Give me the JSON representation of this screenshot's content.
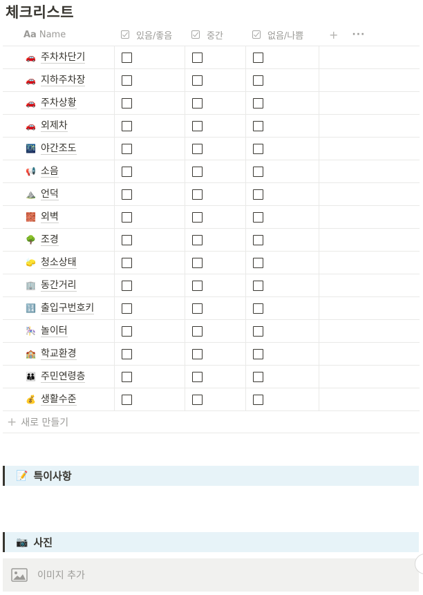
{
  "page": {
    "title": "체크리스트"
  },
  "table": {
    "headers": {
      "name": "Name",
      "col_a": "있음/좋음",
      "col_b": "중간",
      "col_c": "없음/나쁨",
      "name_icon": "Aa",
      "add_icon": "+",
      "more_icon": "···"
    },
    "rows": [
      {
        "emoji": "🚗",
        "label": "주차차단기",
        "checked": [
          false,
          false,
          false
        ]
      },
      {
        "emoji": "🚗",
        "label": "지하주차장",
        "checked": [
          false,
          false,
          false
        ]
      },
      {
        "emoji": "🚗",
        "label": "주차상황",
        "checked": [
          false,
          false,
          false
        ]
      },
      {
        "emoji": "🚗",
        "label": "외제차",
        "checked": [
          false,
          false,
          false
        ]
      },
      {
        "emoji": "🌃",
        "label": "야간조도",
        "checked": [
          false,
          false,
          false
        ]
      },
      {
        "emoji": "📢",
        "label": "소음",
        "checked": [
          false,
          false,
          false
        ]
      },
      {
        "emoji": "⛰️",
        "label": "언덕",
        "checked": [
          false,
          false,
          false
        ]
      },
      {
        "emoji": "🧱",
        "label": "외벽",
        "checked": [
          false,
          false,
          false
        ]
      },
      {
        "emoji": "🌳",
        "label": "조경",
        "checked": [
          false,
          false,
          false
        ]
      },
      {
        "emoji": "🧽",
        "label": "청소상태",
        "checked": [
          false,
          false,
          false
        ]
      },
      {
        "emoji": "🏢",
        "label": "동간거리",
        "checked": [
          false,
          false,
          false
        ]
      },
      {
        "emoji": "🔢",
        "label": "출입구번호키",
        "checked": [
          false,
          false,
          false
        ]
      },
      {
        "emoji": "🎠",
        "label": "놀이터",
        "checked": [
          false,
          false,
          false
        ]
      },
      {
        "emoji": "🏫",
        "label": "학교환경",
        "checked": [
          false,
          false,
          false
        ]
      },
      {
        "emoji": "👪",
        "label": "주민연령층",
        "checked": [
          false,
          false,
          false
        ]
      },
      {
        "emoji": "💰",
        "label": "생활수준",
        "checked": [
          false,
          false,
          false
        ]
      }
    ],
    "new_row": {
      "icon": "+",
      "label": "새로 만들기"
    }
  },
  "callouts": {
    "notes": {
      "emoji": "📝",
      "title": "특이사항"
    },
    "photos": {
      "emoji": "📷",
      "title": "사진"
    }
  },
  "image_block": {
    "icon": "image-icon",
    "label": "이미지 추가"
  },
  "colors": {
    "text": "#37352f",
    "muted": "#9b9a97",
    "divider": "#e9e9e7",
    "callout_bg": "#e7f3f8",
    "image_bg": "#f1f1ef"
  }
}
